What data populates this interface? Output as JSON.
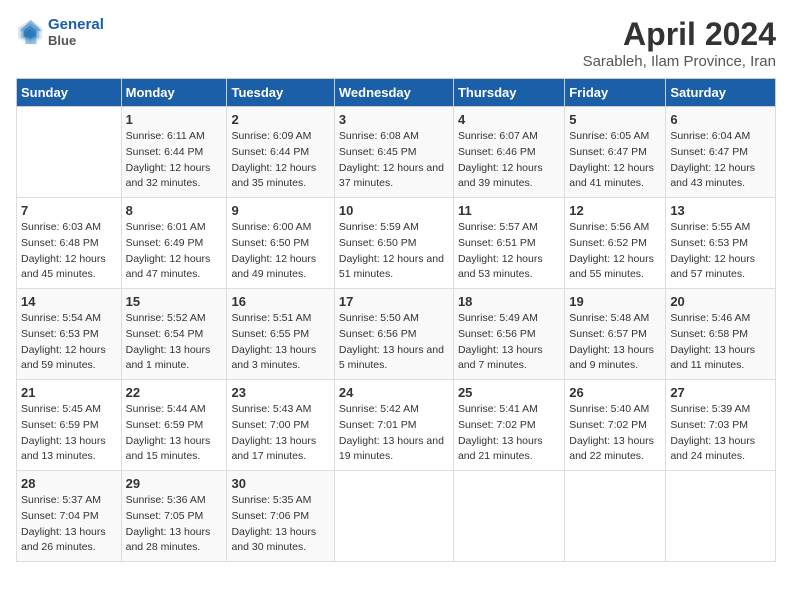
{
  "header": {
    "logo_line1": "General",
    "logo_line2": "Blue",
    "title": "April 2024",
    "subtitle": "Sarableh, Ilam Province, Iran"
  },
  "calendar": {
    "columns": [
      "Sunday",
      "Monday",
      "Tuesday",
      "Wednesday",
      "Thursday",
      "Friday",
      "Saturday"
    ],
    "rows": [
      [
        {
          "day": "",
          "sunrise": "",
          "sunset": "",
          "daylight": ""
        },
        {
          "day": "1",
          "sunrise": "Sunrise: 6:11 AM",
          "sunset": "Sunset: 6:44 PM",
          "daylight": "Daylight: 12 hours and 32 minutes."
        },
        {
          "day": "2",
          "sunrise": "Sunrise: 6:09 AM",
          "sunset": "Sunset: 6:44 PM",
          "daylight": "Daylight: 12 hours and 35 minutes."
        },
        {
          "day": "3",
          "sunrise": "Sunrise: 6:08 AM",
          "sunset": "Sunset: 6:45 PM",
          "daylight": "Daylight: 12 hours and 37 minutes."
        },
        {
          "day": "4",
          "sunrise": "Sunrise: 6:07 AM",
          "sunset": "Sunset: 6:46 PM",
          "daylight": "Daylight: 12 hours and 39 minutes."
        },
        {
          "day": "5",
          "sunrise": "Sunrise: 6:05 AM",
          "sunset": "Sunset: 6:47 PM",
          "daylight": "Daylight: 12 hours and 41 minutes."
        },
        {
          "day": "6",
          "sunrise": "Sunrise: 6:04 AM",
          "sunset": "Sunset: 6:47 PM",
          "daylight": "Daylight: 12 hours and 43 minutes."
        }
      ],
      [
        {
          "day": "7",
          "sunrise": "Sunrise: 6:03 AM",
          "sunset": "Sunset: 6:48 PM",
          "daylight": "Daylight: 12 hours and 45 minutes."
        },
        {
          "day": "8",
          "sunrise": "Sunrise: 6:01 AM",
          "sunset": "Sunset: 6:49 PM",
          "daylight": "Daylight: 12 hours and 47 minutes."
        },
        {
          "day": "9",
          "sunrise": "Sunrise: 6:00 AM",
          "sunset": "Sunset: 6:50 PM",
          "daylight": "Daylight: 12 hours and 49 minutes."
        },
        {
          "day": "10",
          "sunrise": "Sunrise: 5:59 AM",
          "sunset": "Sunset: 6:50 PM",
          "daylight": "Daylight: 12 hours and 51 minutes."
        },
        {
          "day": "11",
          "sunrise": "Sunrise: 5:57 AM",
          "sunset": "Sunset: 6:51 PM",
          "daylight": "Daylight: 12 hours and 53 minutes."
        },
        {
          "day": "12",
          "sunrise": "Sunrise: 5:56 AM",
          "sunset": "Sunset: 6:52 PM",
          "daylight": "Daylight: 12 hours and 55 minutes."
        },
        {
          "day": "13",
          "sunrise": "Sunrise: 5:55 AM",
          "sunset": "Sunset: 6:53 PM",
          "daylight": "Daylight: 12 hours and 57 minutes."
        }
      ],
      [
        {
          "day": "14",
          "sunrise": "Sunrise: 5:54 AM",
          "sunset": "Sunset: 6:53 PM",
          "daylight": "Daylight: 12 hours and 59 minutes."
        },
        {
          "day": "15",
          "sunrise": "Sunrise: 5:52 AM",
          "sunset": "Sunset: 6:54 PM",
          "daylight": "Daylight: 13 hours and 1 minute."
        },
        {
          "day": "16",
          "sunrise": "Sunrise: 5:51 AM",
          "sunset": "Sunset: 6:55 PM",
          "daylight": "Daylight: 13 hours and 3 minutes."
        },
        {
          "day": "17",
          "sunrise": "Sunrise: 5:50 AM",
          "sunset": "Sunset: 6:56 PM",
          "daylight": "Daylight: 13 hours and 5 minutes."
        },
        {
          "day": "18",
          "sunrise": "Sunrise: 5:49 AM",
          "sunset": "Sunset: 6:56 PM",
          "daylight": "Daylight: 13 hours and 7 minutes."
        },
        {
          "day": "19",
          "sunrise": "Sunrise: 5:48 AM",
          "sunset": "Sunset: 6:57 PM",
          "daylight": "Daylight: 13 hours and 9 minutes."
        },
        {
          "day": "20",
          "sunrise": "Sunrise: 5:46 AM",
          "sunset": "Sunset: 6:58 PM",
          "daylight": "Daylight: 13 hours and 11 minutes."
        }
      ],
      [
        {
          "day": "21",
          "sunrise": "Sunrise: 5:45 AM",
          "sunset": "Sunset: 6:59 PM",
          "daylight": "Daylight: 13 hours and 13 minutes."
        },
        {
          "day": "22",
          "sunrise": "Sunrise: 5:44 AM",
          "sunset": "Sunset: 6:59 PM",
          "daylight": "Daylight: 13 hours and 15 minutes."
        },
        {
          "day": "23",
          "sunrise": "Sunrise: 5:43 AM",
          "sunset": "Sunset: 7:00 PM",
          "daylight": "Daylight: 13 hours and 17 minutes."
        },
        {
          "day": "24",
          "sunrise": "Sunrise: 5:42 AM",
          "sunset": "Sunset: 7:01 PM",
          "daylight": "Daylight: 13 hours and 19 minutes."
        },
        {
          "day": "25",
          "sunrise": "Sunrise: 5:41 AM",
          "sunset": "Sunset: 7:02 PM",
          "daylight": "Daylight: 13 hours and 21 minutes."
        },
        {
          "day": "26",
          "sunrise": "Sunrise: 5:40 AM",
          "sunset": "Sunset: 7:02 PM",
          "daylight": "Daylight: 13 hours and 22 minutes."
        },
        {
          "day": "27",
          "sunrise": "Sunrise: 5:39 AM",
          "sunset": "Sunset: 7:03 PM",
          "daylight": "Daylight: 13 hours and 24 minutes."
        }
      ],
      [
        {
          "day": "28",
          "sunrise": "Sunrise: 5:37 AM",
          "sunset": "Sunset: 7:04 PM",
          "daylight": "Daylight: 13 hours and 26 minutes."
        },
        {
          "day": "29",
          "sunrise": "Sunrise: 5:36 AM",
          "sunset": "Sunset: 7:05 PM",
          "daylight": "Daylight: 13 hours and 28 minutes."
        },
        {
          "day": "30",
          "sunrise": "Sunrise: 5:35 AM",
          "sunset": "Sunset: 7:06 PM",
          "daylight": "Daylight: 13 hours and 30 minutes."
        },
        {
          "day": "",
          "sunrise": "",
          "sunset": "",
          "daylight": ""
        },
        {
          "day": "",
          "sunrise": "",
          "sunset": "",
          "daylight": ""
        },
        {
          "day": "",
          "sunrise": "",
          "sunset": "",
          "daylight": ""
        },
        {
          "day": "",
          "sunrise": "",
          "sunset": "",
          "daylight": ""
        }
      ]
    ]
  }
}
